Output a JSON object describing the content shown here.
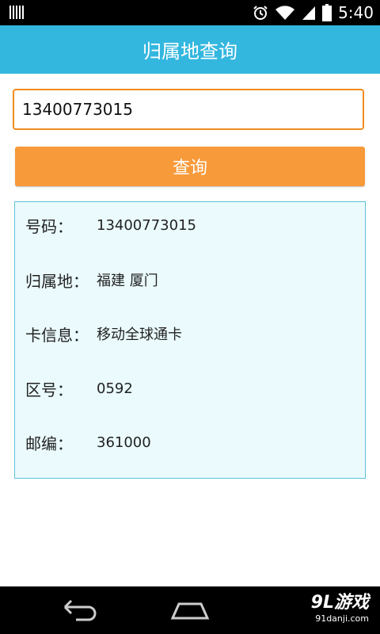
{
  "status_bar": {
    "time": "5:40",
    "icons": [
      "signal-bars-icon",
      "alarm-clock-icon",
      "wifi-icon",
      "cell-signal-icon",
      "battery-icon"
    ]
  },
  "header": {
    "title": "归属地查询",
    "background": "#33b7df"
  },
  "search": {
    "value": "13400773015",
    "button_label": "查询",
    "button_color": "#f79a3a",
    "border_color": "#f08c1e"
  },
  "result": {
    "number": {
      "label": "号码：",
      "value": "13400773015"
    },
    "location": {
      "label": "归属地：",
      "value": "福建 厦门"
    },
    "card_info": {
      "label": "卡信息：",
      "value": "移动全球通卡"
    },
    "area_code": {
      "label": "区号：",
      "value": "0592"
    },
    "postal_code": {
      "label": "邮编：",
      "value": "361000"
    }
  },
  "nav": {
    "icons": [
      "back-icon",
      "home-icon"
    ]
  },
  "watermark": {
    "brand": "9L游戏",
    "url": "91danji.com"
  }
}
